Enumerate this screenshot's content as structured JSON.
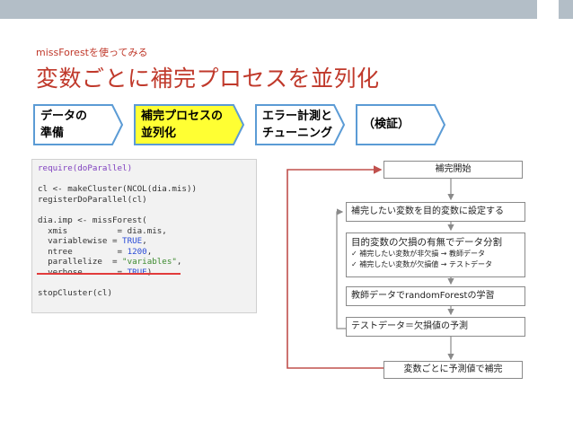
{
  "slide": {
    "subtitle": "missForestを使ってみる",
    "title": "変数ごとに補完プロセスを並列化"
  },
  "steps": [
    {
      "line1": "データの",
      "line2": "準備",
      "fill": "#ffffff",
      "border": "#5b9bd5"
    },
    {
      "line1": "補完プロセスの",
      "line2": "並列化",
      "fill": "#ffff33",
      "border": "#5b9bd5"
    },
    {
      "line1": "エラー計測と",
      "line2": "チューニング",
      "fill": "#ffffff",
      "border": "#5b9bd5"
    },
    {
      "line1": "（検証）",
      "line2": "",
      "fill": "#ffffff",
      "border": "#5b9bd5"
    }
  ],
  "code": {
    "l1": "require(doParallel)",
    "l2": "cl <- makeCluster(NCOL(dia.mis))",
    "l3": "registerDoParallel(cl)",
    "l4": "dia.imp <- missForest(",
    "l5a": "  xmis          = dia.mis,",
    "l6a": "  variablewise = ",
    "l6b": "TRUE",
    "l6c": ",",
    "l7a": "  ntree         = ",
    "l7b": "1200",
    "l7c": ",",
    "l8a": "  parallelize  = ",
    "l8b": "\"variables\"",
    "l8c": ",",
    "l9a": "  verbose       = ",
    "l9b": "TRUE",
    "l9c": ")",
    "l10": "stopCluster(cl)"
  },
  "flow": {
    "start": "補完開始",
    "set_target": "補完したい変数を目的変数に設定する",
    "split_title": "目的変数の欠損の有無でデータ分割",
    "split_item1": "補完したい変数が非欠損 → 教師データ",
    "split_item2": "補完したい変数が欠損値 → テストデータ",
    "learn": "教師データでrandomForestの学習",
    "predict": "テストデータ＝欠損値の予測",
    "end": "変数ごとに予測値で補完",
    "check": "✓"
  },
  "colors": {
    "title": "#c0392b",
    "loop_line": "#c0504d",
    "highlight_step": "#ffff33",
    "underline": "#e23b3b"
  }
}
